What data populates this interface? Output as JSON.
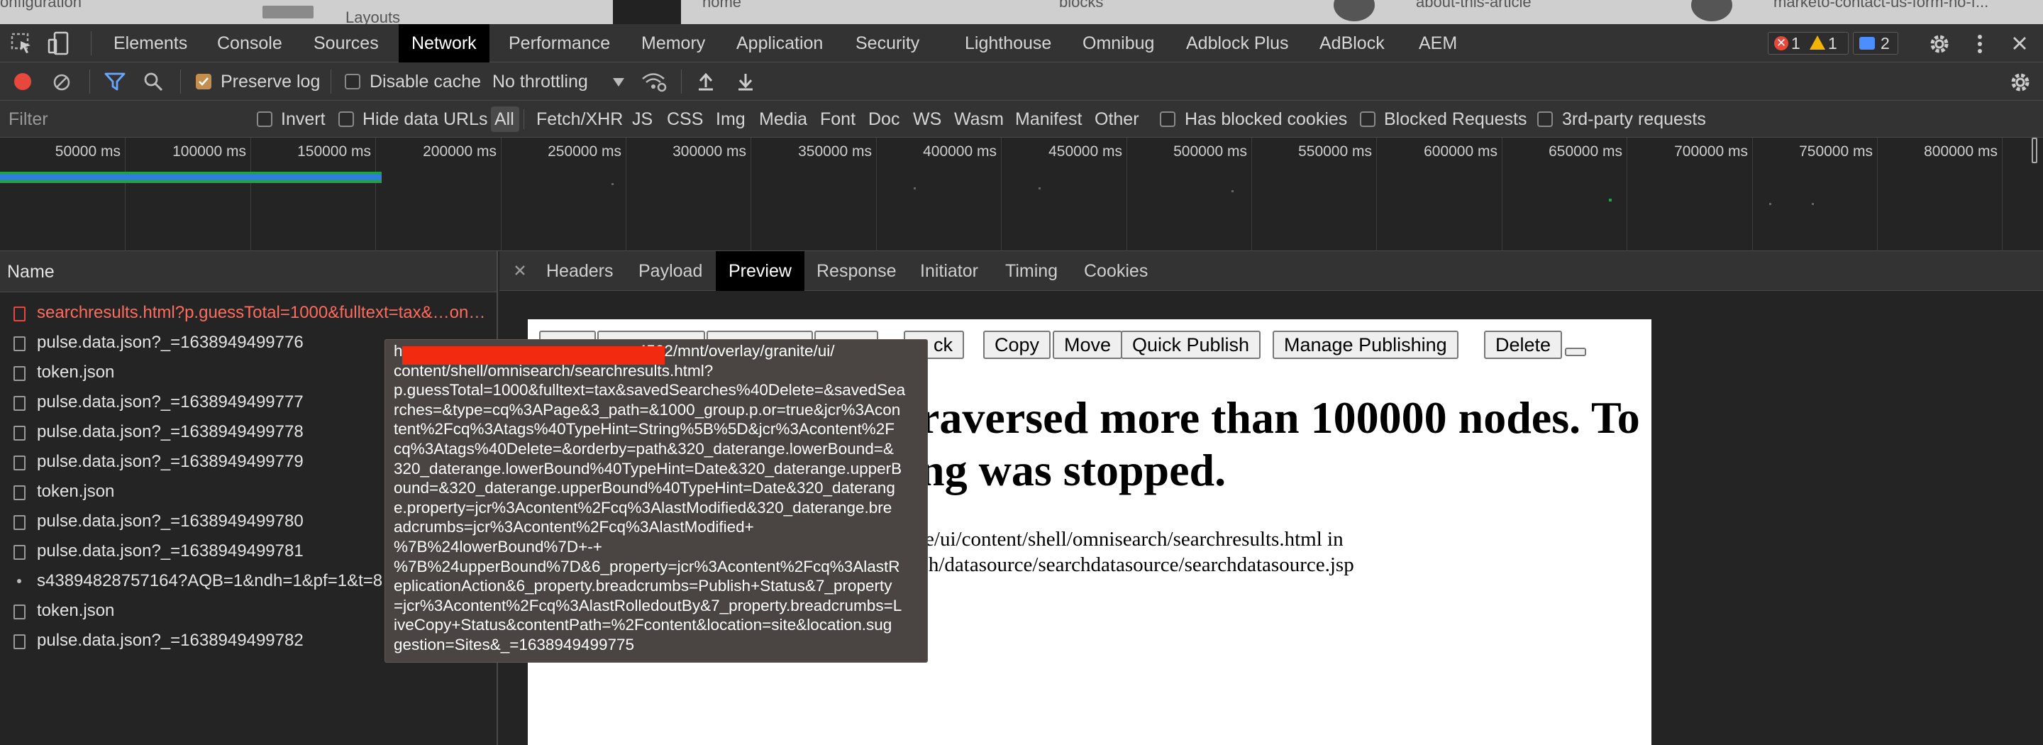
{
  "browser_tabs": [
    {
      "label": "onfiguration"
    },
    {
      "label": "Layouts"
    },
    {
      "label": "home"
    },
    {
      "label": "blocks"
    },
    {
      "label": "about-this-article"
    },
    {
      "label": "marketo-contact-us-form-no-f..."
    }
  ],
  "main_tabs": [
    {
      "label": "Elements"
    },
    {
      "label": "Console"
    },
    {
      "label": "Sources"
    },
    {
      "label": "Network",
      "active": true
    },
    {
      "label": "Performance"
    },
    {
      "label": "Memory"
    },
    {
      "label": "Application"
    },
    {
      "label": "Security"
    },
    {
      "label": "Lighthouse"
    },
    {
      "label": "Omnibug"
    },
    {
      "label": "Adblock Plus"
    },
    {
      "label": "AdBlock"
    },
    {
      "label": "AEM"
    }
  ],
  "badges": {
    "errors": "1",
    "warnings": "1",
    "messages": "2"
  },
  "net_toolbar": {
    "preserve_log": "Preserve log",
    "disable_cache": "Disable cache",
    "throttling": "No throttling"
  },
  "filter_row": {
    "placeholder": "Filter",
    "invert": "Invert",
    "hide_data_urls": "Hide data URLs",
    "types": [
      "All",
      "Fetch/XHR",
      "JS",
      "CSS",
      "Img",
      "Media",
      "Font",
      "Doc",
      "WS",
      "Wasm",
      "Manifest",
      "Other"
    ],
    "has_blocked_cookies": "Has blocked cookies",
    "blocked_requests": "Blocked Requests",
    "third_party": "3rd-party requests"
  },
  "timeline_ticks": [
    "50000 ms",
    "100000 ms",
    "150000 ms",
    "200000 ms",
    "250000 ms",
    "300000 ms",
    "350000 ms",
    "400000 ms",
    "450000 ms",
    "500000 ms",
    "550000 ms",
    "600000 ms",
    "650000 ms",
    "700000 ms",
    "750000 ms",
    "800000 ms"
  ],
  "requests": {
    "header": "Name",
    "rows": [
      {
        "name": "searchresults.html?p.guessTotal=1000&fulltext=tax&…on…",
        "status": "error"
      },
      {
        "name": "pulse.data.json?_=1638949499776"
      },
      {
        "name": "token.json"
      },
      {
        "name": "pulse.data.json?_=1638949499777"
      },
      {
        "name": "pulse.data.json?_=1638949499778"
      },
      {
        "name": "pulse.data.json?_=1638949499779"
      },
      {
        "name": "token.json"
      },
      {
        "name": "pulse.data.json?_=1638949499780"
      },
      {
        "name": "pulse.data.json?_=1638949499781"
      },
      {
        "name": "s43894828757164?AQB=1&ndh=1&pf=1&t=8"
      },
      {
        "name": "token.json"
      },
      {
        "name": "pulse.data.json?_=1638949499782"
      }
    ]
  },
  "detail_tabs": [
    {
      "label": "Headers"
    },
    {
      "label": "Payload"
    },
    {
      "label": "Preview",
      "active": true
    },
    {
      "label": "Response"
    },
    {
      "label": "Initiator"
    },
    {
      "label": "Timing"
    },
    {
      "label": "Cookies"
    }
  ],
  "preview": {
    "buttons": [
      "ck",
      "Copy",
      "Move",
      "Quick Publish",
      "Manage Publishing",
      "Delete"
    ],
    "title_line1": "raversed more than 100000 nodes. To avoid affecting",
    "title_line2": "ng was stopped.",
    "path_line1": "te/ui/content/shell/omnisearch/searchresults.html in",
    "path_line2": "ch/datasource/searchdatasource/searchdatasource.jsp"
  },
  "tooltip": {
    "lines": [
      "h                                                    :4502/mnt/overlay/granite/ui/",
      "content/shell/omnisearch/searchresults.html?",
      "p.guessTotal=1000&fulltext=tax&savedSearches%40Delete=&savedSea",
      "rches=&type=cq%3APage&3_path=&1000_group.p.or=true&jcr%3Acon",
      "tent%2Fcq%3Atags%40TypeHint=String%5B%5D&jcr%3Acontent%2F",
      "cq%3Atags%40Delete=&orderby=path&320_daterange.lowerBound=&",
      "320_daterange.lowerBound%40TypeHint=Date&320_daterange.upperB",
      "ound=&320_daterange.upperBound%40TypeHint=Date&320_daterang",
      "e.property=jcr%3Acontent%2Fcq%3AlastModified&320_daterange.bre",
      "adcrumbs=jcr%3Acontent%2Fcq%3AlastModified+",
      "%7B%24lowerBound%7D+-+",
      "%7B%24upperBound%7D&6_property=jcr%3Acontent%2Fcq%3AlastR",
      "eplicationAction&6_property.breadcrumbs=Publish+Status&7_property",
      "=jcr%3Acontent%2Fcq%3AlastRolledoutBy&7_property.breadcrumbs=L",
      "iveCopy+Status&contentPath=%2Fcontent&location=site&location.sug",
      "gestion=Sites&_=1638949499775"
    ]
  },
  "colors": {
    "active_tab_bg": "#000000",
    "error_red": "#e8473b",
    "record_red": "#e8473b",
    "checkbox_accent": "#c68e4e",
    "timeline_green": "#1ea446",
    "timeline_blue": "#2f7de1",
    "filter_blue": "#6aa6ff"
  }
}
